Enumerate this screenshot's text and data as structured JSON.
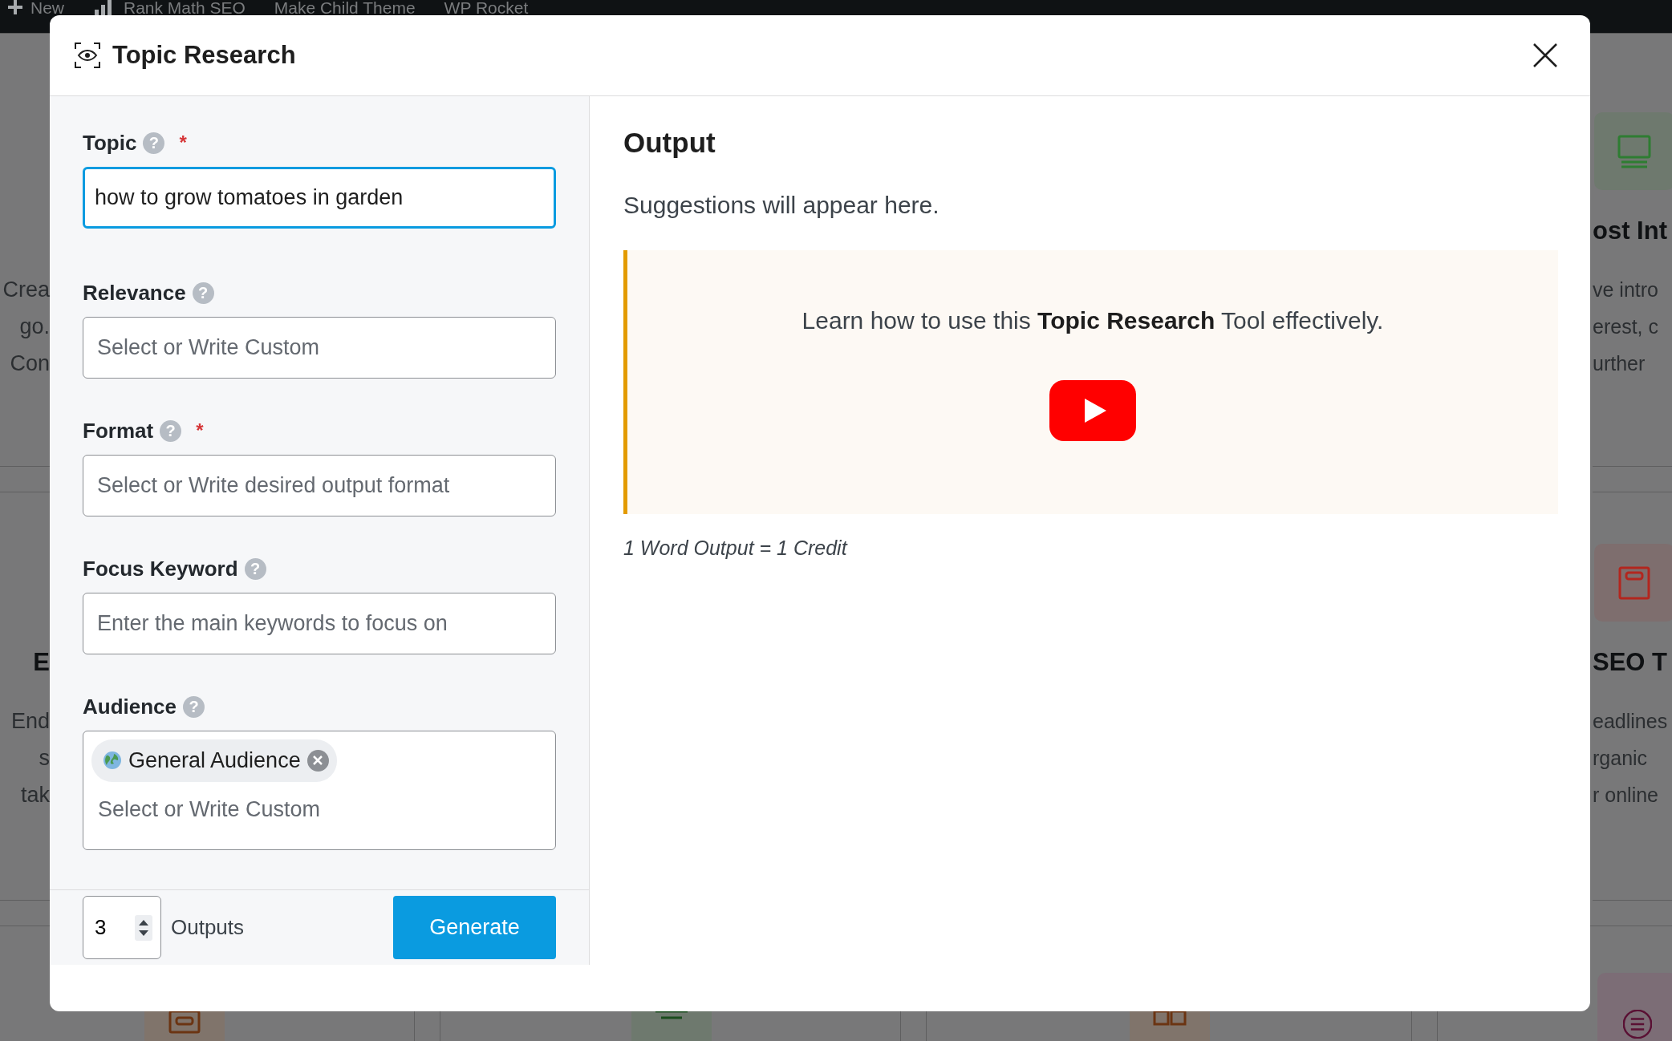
{
  "admin_bar": {
    "items": [
      "New",
      "Rank Math SEO",
      "Make Child Theme",
      "WP Rocket"
    ]
  },
  "background": {
    "left_cards": [
      {
        "lines": [
          "Crea",
          "go.",
          "Con"
        ]
      },
      {
        "heading": "E",
        "lines": [
          "End",
          "s",
          "tak"
        ]
      }
    ],
    "right_cards": [
      {
        "color": "#6e796e",
        "heading": "ost Int",
        "lines": [
          "ve intro",
          "erest, c",
          "urther"
        ]
      },
      {
        "color": "#7e6e6e",
        "heading": "SEO T",
        "lines": [
          "eadlines",
          "rganic",
          "r online"
        ]
      }
    ],
    "bottom_tiles": [
      {
        "color": "#80746b"
      },
      {
        "color": "#6e796e"
      },
      {
        "color": "#80746b"
      },
      {
        "color": "#7c6d76"
      }
    ]
  },
  "modal": {
    "title": "Topic Research",
    "fields": [
      {
        "kind": "text",
        "label": "Topic",
        "help_mark": "?",
        "required_mark": "*",
        "value": "how to grow tomatoes in garden",
        "focused": true
      },
      {
        "kind": "text",
        "label": "Relevance",
        "help_mark": "?",
        "placeholder": "Select or Write Custom",
        "focused": false
      },
      {
        "kind": "text",
        "label": "Format",
        "help_mark": "?",
        "required_mark": "*",
        "placeholder": "Select or Write desired output format",
        "focused": false
      },
      {
        "kind": "text",
        "label": "Focus Keyword",
        "help_mark": "?",
        "placeholder": "Enter the main keywords to focus on",
        "focused": false
      },
      {
        "kind": "tags",
        "label": "Audience",
        "help_mark": "?",
        "tags": [
          {
            "label": "General Audience"
          }
        ],
        "placeholder": "Select or Write Custom",
        "focused": false
      }
    ],
    "footer": {
      "outputs_value": "3",
      "outputs_label": "Outputs",
      "generate": "Generate"
    },
    "output": {
      "heading": "Output",
      "empty_text": "Suggestions will appear here.",
      "tip": "Learn how to use this **Topic Research** Tool effectively.",
      "credit_note": "1 Word Output = 1 Credit"
    }
  }
}
